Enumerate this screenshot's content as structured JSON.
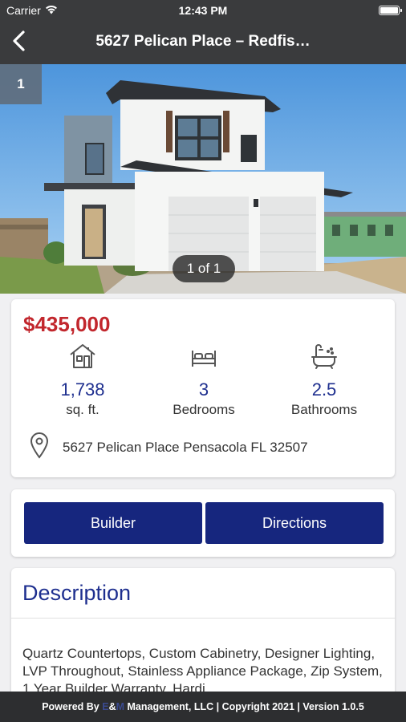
{
  "status_bar": {
    "carrier": "Carrier",
    "time": "12:43 PM"
  },
  "nav": {
    "title": "5627 Pelican Place – Redfis…"
  },
  "gallery": {
    "current_index": "1",
    "counter": "1 of 1"
  },
  "listing": {
    "price": "$435,000",
    "sqft_value": "1,738",
    "sqft_label": "sq. ft.",
    "bedrooms_value": "3",
    "bedrooms_label": "Bedrooms",
    "bathrooms_value": "2.5",
    "bathrooms_label": "Bathrooms",
    "address": "5627 Pelican Place Pensacola FL 32507"
  },
  "buttons": {
    "builder": "Builder",
    "directions": "Directions"
  },
  "description": {
    "title": "Description",
    "text": "Quartz Countertops, Custom Cabinetry, Designer Lighting, LVP Throughout, Stainless Appliance Package, Zip System, 1 Year Builder Warranty, Hardi"
  },
  "footer": {
    "prefix": "Powered By ",
    "brand_e": "E",
    "brand_amp": "&",
    "brand_m": "M",
    "suffix": " Management, LLC | Copyright 2021 | Version 1.0.5"
  },
  "colors": {
    "price": "#c2272d",
    "accent": "#1e2f8f",
    "button": "#16267e",
    "bar": "#3a3b3d"
  },
  "icons": [
    "wifi-icon",
    "battery-icon",
    "back-chevron-icon",
    "house-icon",
    "bed-icon",
    "bathtub-icon",
    "map-pin-icon"
  ]
}
